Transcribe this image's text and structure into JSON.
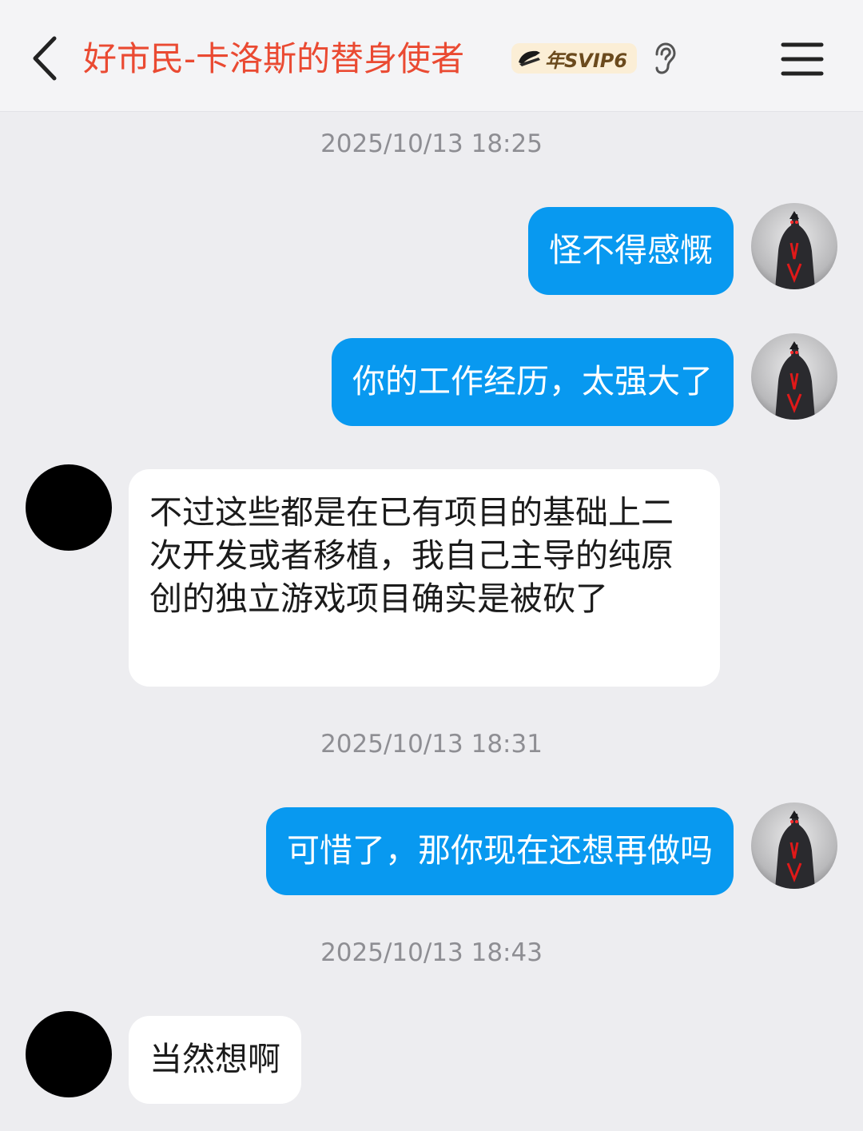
{
  "header": {
    "title": "好市民-卡洛斯的替身使者",
    "vip_label": "年SVIP6",
    "back_icon": "chevron-left-icon",
    "ear_icon": "ear-icon",
    "menu_icon": "hamburger-menu-icon",
    "title_color": "#ea4a32"
  },
  "colors": {
    "my_bubble": "#0899f0",
    "their_bubble": "#ffffff",
    "background": "#ededf0"
  },
  "timestamps": [
    "2025/10/13 18:25",
    "2025/10/13 18:31",
    "2025/10/13 18:43"
  ],
  "messages": [
    {
      "sender": "me",
      "text": "怪不得感慨"
    },
    {
      "sender": "me",
      "text": "你的工作经历，太强大了"
    },
    {
      "sender": "them",
      "text": "不过这些都是在已有项目的基础上二次开发或者移植，我自己主导的纯原创的独立游戏项目确实是被砍了"
    },
    {
      "sender": "me",
      "text": "可惜了，那你现在还想再做吗"
    },
    {
      "sender": "them",
      "text": "当然想啊"
    }
  ]
}
